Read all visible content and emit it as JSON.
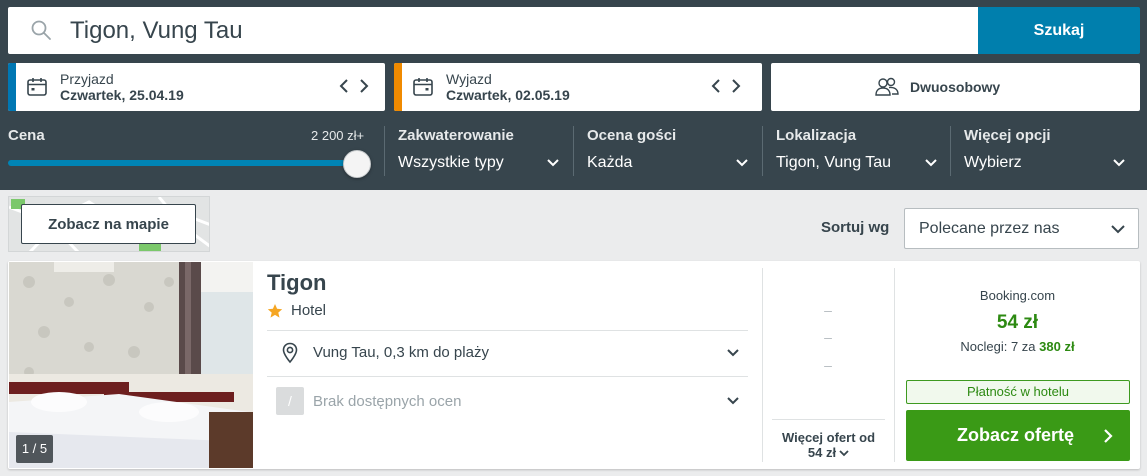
{
  "search": {
    "query": "Tigon, Vung Tau",
    "button_label": "Szukaj"
  },
  "dates": {
    "checkin": {
      "label": "Przyjazd",
      "value": "Czwartek, 25.04.19",
      "accent": "#0077b3"
    },
    "checkout": {
      "label": "Wyjazd",
      "value": "Czwartek, 02.05.19",
      "accent": "#f08a00"
    }
  },
  "guests": {
    "label": "Dwuosobowy"
  },
  "filters": {
    "price": {
      "label": "Cena",
      "max_label": "2 200 zł+",
      "level_fraction": 1.0
    },
    "accommodation": {
      "label": "Zakwaterowanie",
      "value": "Wszystkie typy"
    },
    "guest_rating": {
      "label": "Ocena gości",
      "value": "Każda"
    },
    "location": {
      "label": "Lokalizacja",
      "value": "Tigon, Vung Tau"
    },
    "more": {
      "label": "Więcej opcji",
      "value": "Wybierz"
    }
  },
  "map": {
    "button_label": "Zobacz na mapie"
  },
  "sort": {
    "label": "Sortuj wg",
    "value": "Polecane przez nas"
  },
  "result": {
    "photo_counter": "1 / 5",
    "name": "Tigon",
    "type": "Hotel",
    "stars": 1,
    "location_text": "Vung Tau, 0,3 km do plaży",
    "rating_badge": "/",
    "rating_text": "Brak dostępnych ocen",
    "alt_prices": [
      "–",
      "–",
      "–"
    ],
    "more_offers_line1": "Więcej ofert od",
    "more_offers_line2": "54 zł",
    "provider": "Booking.com",
    "price": "54 zł",
    "nights_prefix": "Noclegi: 7 za",
    "nights_total": "380 zł",
    "payment_badge": "Płatność w hotelu",
    "deal_button": "Zobacz ofertę"
  },
  "colors": {
    "header_bg": "#37454d",
    "search_button": "#007fad",
    "slider": "#0084b5",
    "deal_green": "#3a9a16",
    "price_green": "#2d8a12",
    "star": "#f5a623"
  },
  "icons": {
    "search": "search-icon",
    "calendar": "calendar-icon",
    "guests": "guests-icon",
    "location": "location-pin-icon",
    "star": "star-icon",
    "chevron": "chevron-down-icon"
  }
}
